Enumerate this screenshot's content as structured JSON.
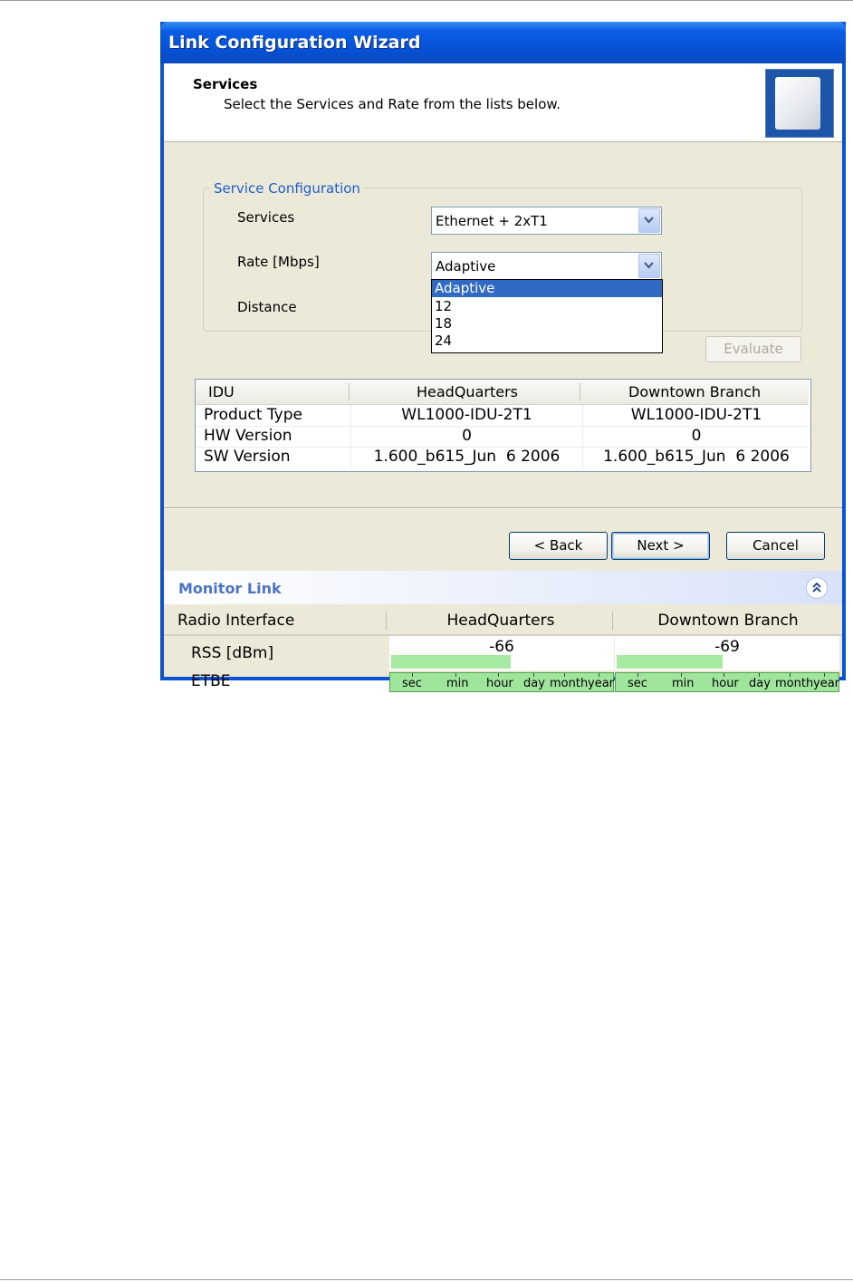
{
  "window": {
    "title": "Link Configuration Wizard"
  },
  "header": {
    "title": "Services",
    "subtitle": "Select the Services and Rate from the lists below.",
    "image_icon": "radio-unit-icon"
  },
  "service_config": {
    "legend": "Service Configuration",
    "services_label": "Services",
    "services_value": "Ethernet + 2xT1",
    "rate_label": "Rate [Mbps]",
    "rate_value": "Adaptive",
    "distance_label": "Distance",
    "rate_options": [
      "Adaptive",
      "12",
      "18",
      "24"
    ],
    "rate_selected_index": 0,
    "evaluate_label": "Evaluate"
  },
  "idu_table": {
    "columns": [
      "IDU",
      "HeadQuarters",
      "Downtown Branch"
    ],
    "rows": [
      [
        "Product Type",
        "WL1000-IDU-2T1",
        "WL1000-IDU-2T1"
      ],
      [
        "HW Version",
        "0",
        "0"
      ],
      [
        "SW Version",
        "1.600_b615_Jun  6 2006",
        "1.600_b615_Jun  6 2006"
      ]
    ]
  },
  "buttons": {
    "back": "< Back",
    "next": "Next >",
    "cancel": "Cancel"
  },
  "monitor": {
    "title": "Monitor Link",
    "columns": [
      "Radio Interface",
      "HeadQuarters",
      "Downtown Branch"
    ],
    "rss_label": "RSS [dBm]",
    "rss_values": [
      "-66",
      "-69"
    ],
    "rss_bar_fraction": [
      0.54,
      0.48
    ],
    "etbe_label": "ETBE",
    "etbe_scale": [
      "sec",
      "min",
      "hour",
      "day",
      "month",
      "year"
    ]
  },
  "colors": {
    "title_bar": "#0750d2",
    "selection": "#316ac5",
    "legend": "#1c5ecf",
    "rss_bar": "#a6e9a0",
    "etbe_bar": "#9fe59b"
  }
}
